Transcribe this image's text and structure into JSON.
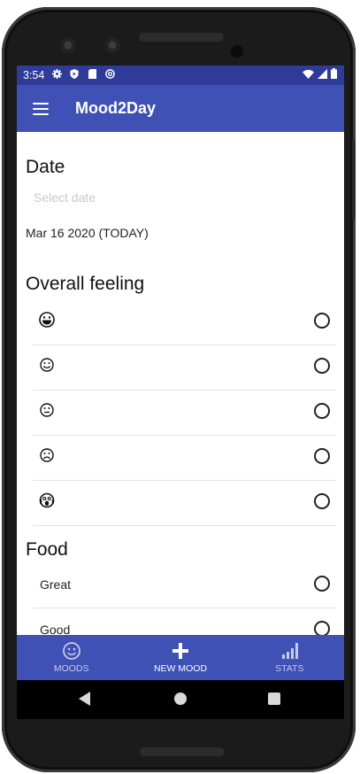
{
  "status_bar": {
    "time": "3:54",
    "icons": [
      "gear-icon",
      "shield-icon",
      "sd-card-icon",
      "at-icon"
    ],
    "right_icons": [
      "wifi-icon",
      "signal-icon",
      "battery-icon"
    ]
  },
  "app_bar": {
    "menu_icon": "hamburger-menu-icon",
    "title": "Mood2Day"
  },
  "date_section": {
    "title": "Date",
    "placeholder": "Select date",
    "value": "Mar 16 2020  (TODAY)"
  },
  "feeling_section": {
    "title": "Overall feeling",
    "options": [
      {
        "icon": "grinning-face-icon",
        "selected": false
      },
      {
        "icon": "smiling-face-icon",
        "selected": false
      },
      {
        "icon": "neutral-face-icon",
        "selected": false
      },
      {
        "icon": "frowning-face-icon",
        "selected": false
      },
      {
        "icon": "screaming-face-icon",
        "selected": false
      }
    ]
  },
  "food_section": {
    "title": "Food",
    "options": [
      {
        "label": "Great",
        "selected": false
      },
      {
        "label": "Good",
        "selected": false
      }
    ]
  },
  "bottom_nav": {
    "items": [
      {
        "label": "MOODS",
        "icon": "smiley-icon",
        "active": false
      },
      {
        "label": "NEW MOOD",
        "icon": "plus-icon",
        "active": true
      },
      {
        "label": "STATS",
        "icon": "bar-chart-icon",
        "active": false
      }
    ]
  },
  "colors": {
    "primary": "#3f51b5",
    "primary_dark": "#2f3b99",
    "inactive_nav": "#c5cae9"
  }
}
